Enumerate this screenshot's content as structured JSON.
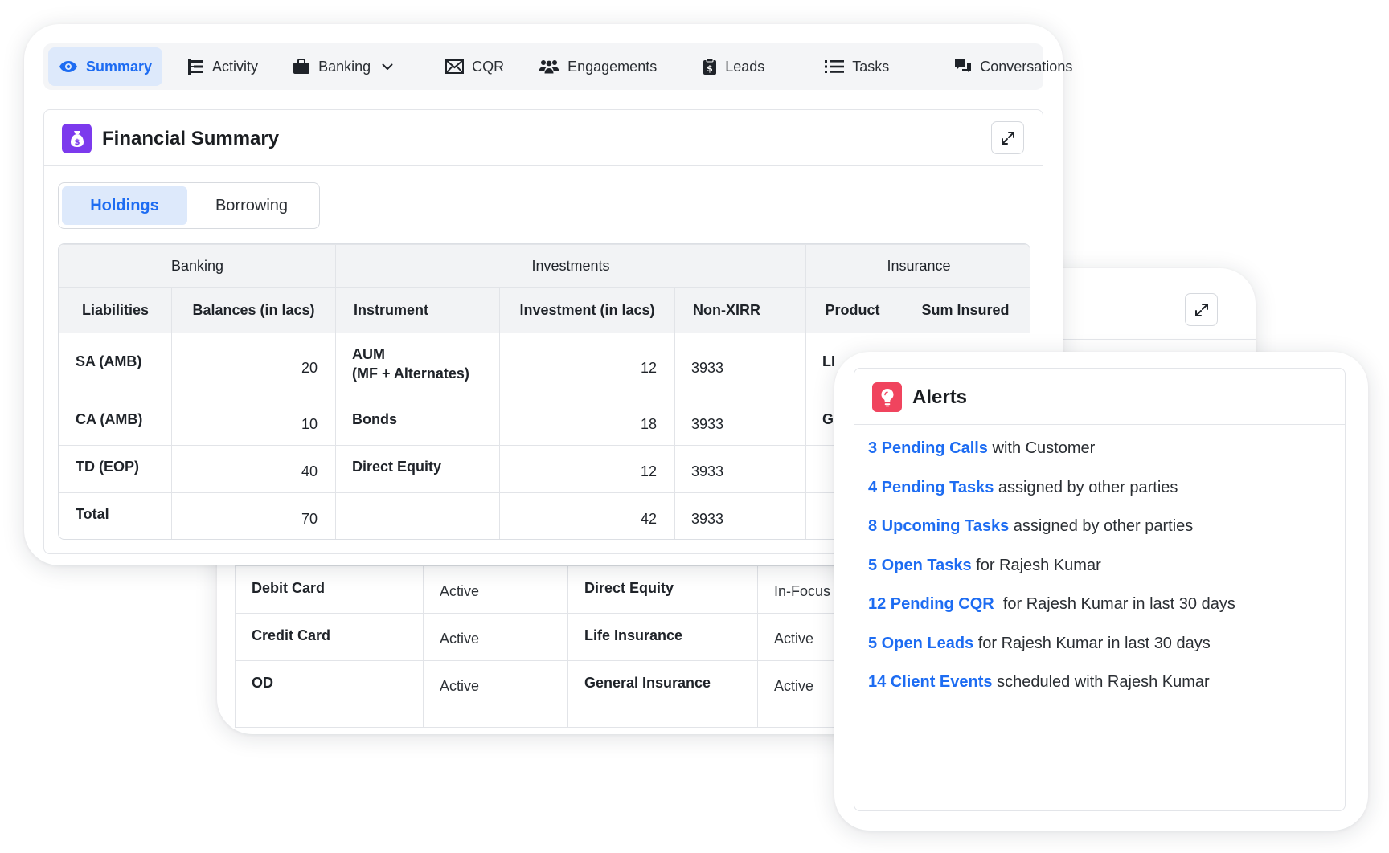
{
  "tabs": [
    {
      "label": "Summary",
      "icon": "eye-icon",
      "active": true
    },
    {
      "label": "Activity",
      "icon": "timeline-icon"
    },
    {
      "label": "Banking",
      "icon": "briefcase-icon"
    },
    {
      "label": "CQR",
      "icon": "envelope-icon"
    },
    {
      "label": "Engagements",
      "icon": "users-icon"
    },
    {
      "label": "Leads",
      "icon": "clipboard-dollar-icon"
    },
    {
      "label": "Tasks",
      "icon": "list-icon"
    },
    {
      "label": "Conversations",
      "icon": "chat-icon"
    }
  ],
  "financial_summary": {
    "title": "Financial Summary",
    "icon": "money-bag-icon",
    "segments": {
      "holdings": "Holdings",
      "borrowing": "Borrowing"
    },
    "groups": {
      "banking": "Banking",
      "investments": "Investments",
      "insurance": "Insurance"
    },
    "columns": {
      "liabilities": "Liabilities",
      "balances": "Balances (in lacs)",
      "instrument": "Instrument",
      "investment": "Investment (in lacs)",
      "non_xirr": "Non-XIRR",
      "product": "Product",
      "sum_insured": "Sum Insured"
    },
    "rows": [
      {
        "liability": "SA (AMB)",
        "balance": "20",
        "instrument_line1": "AUM",
        "instrument_line2": "(MF + Alternates)",
        "investment": "12",
        "non_xirr": "3933",
        "product": "LI",
        "sum_insured": ""
      },
      {
        "liability": "CA (AMB)",
        "balance": "10",
        "instrument": "Bonds",
        "investment": "18",
        "non_xirr": "3933",
        "product": "G",
        "sum_insured": ""
      },
      {
        "liability": "TD (EOP)",
        "balance": "40",
        "instrument": "Direct Equity",
        "investment": "12",
        "non_xirr": "3933",
        "product": "",
        "sum_insured": ""
      },
      {
        "liability": "Total",
        "balance": "70",
        "instrument": "",
        "investment": "42",
        "non_xirr": "3933",
        "product": "",
        "sum_insured": ""
      }
    ]
  },
  "status_table": {
    "rows": [
      {
        "product": "Debit Card",
        "status": "Active",
        "product2": "Direct Equity",
        "status2": "In-Focus"
      },
      {
        "product": "Credit Card",
        "status": "Active",
        "product2": "Life Insurance",
        "status2": "Active"
      },
      {
        "product": "OD",
        "status": "Active",
        "product2": "General Insurance",
        "status2": "Active"
      }
    ]
  },
  "alerts": {
    "title": "Alerts",
    "icon": "lightbulb-icon",
    "items": [
      {
        "link": "3 Pending Calls",
        "text": " with Customer"
      },
      {
        "link": "4 Pending Tasks",
        "text": " assigned by other parties"
      },
      {
        "link": "8 Upcoming Tasks",
        "text": " assigned by other parties"
      },
      {
        "link": "5 Open Tasks",
        "text": " for Rajesh Kumar"
      },
      {
        "link": "12 Pending CQR",
        "text": "  for Rajesh Kumar in last 30 days"
      },
      {
        "link": "5 Open Leads",
        "text": " for Rajesh Kumar in last 30 days"
      },
      {
        "link": "14 Client Events",
        "text": " scheduled with Rajesh Kumar"
      }
    ]
  },
  "colors": {
    "accent": "#1d6cf2",
    "active_tab_bg": "#dde9fb",
    "financial_icon_bg": "#7c3aed",
    "alerts_icon_bg": "#f0445e"
  }
}
